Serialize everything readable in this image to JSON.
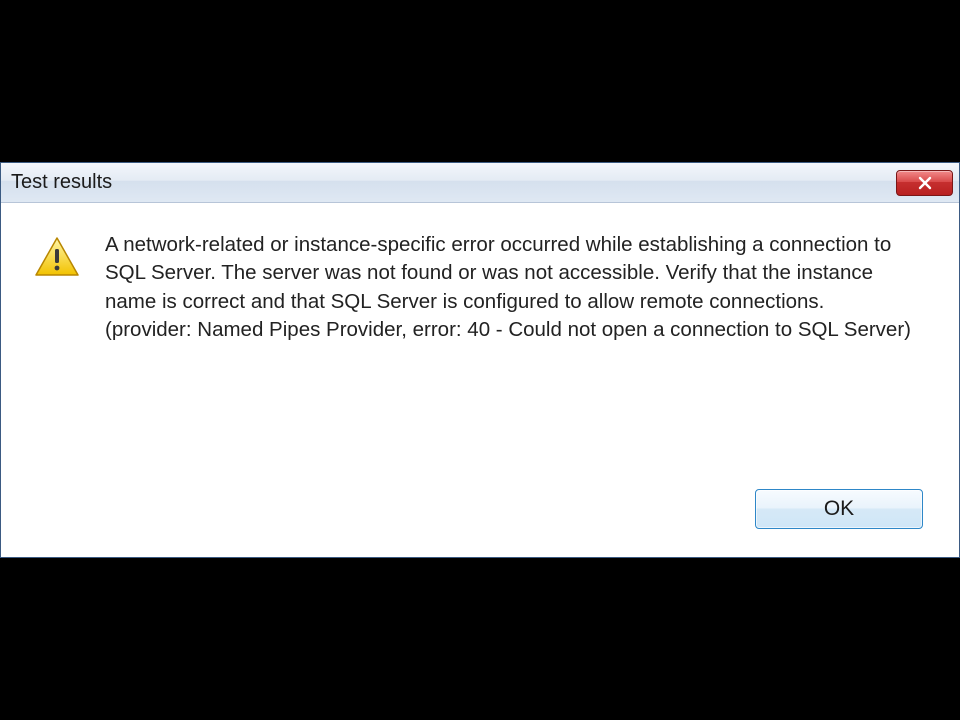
{
  "dialog": {
    "title": "Test results",
    "message": "A network-related or instance-specific error occurred while establishing a connection to SQL Server. The server was not found or was not accessible. Verify that the instance name is correct and that SQL Server is configured to allow remote connections. (provider: Named Pipes Provider, error: 40 - Could not open a connection to SQL Server)",
    "ok_label": "OK",
    "icon": "warning-icon"
  }
}
